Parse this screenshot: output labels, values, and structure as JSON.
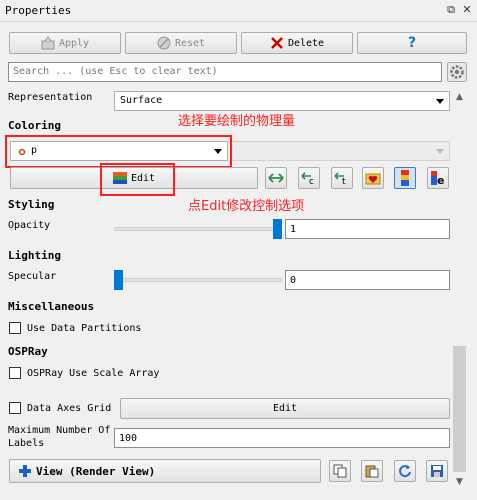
{
  "panel": {
    "title": "Properties"
  },
  "toolbar": {
    "apply": "Apply",
    "reset": "Reset",
    "delete": "Delete",
    "help": "?"
  },
  "search": {
    "placeholder": "Search ... (use Esc to clear text)"
  },
  "representation": {
    "label": "Representation",
    "value": "Surface"
  },
  "coloring": {
    "section": "Coloring",
    "array": "p",
    "edit": "Edit",
    "annotation_select": "选择要绘制的物理量",
    "annotation_edit": "点Edit修改控制选项"
  },
  "styling": {
    "section": "Styling",
    "opacity_label": "Opacity",
    "opacity_value": "1",
    "opacity_fraction": 1.0
  },
  "lighting": {
    "section": "Lighting",
    "specular_label": "Specular",
    "specular_value": "0",
    "specular_fraction": 0.0
  },
  "miscellaneous": {
    "section": "Miscellaneous",
    "use_data_partitions": "Use Data Partitions"
  },
  "ospray": {
    "section": "OSPRay",
    "use_scale_array": "OSPRay Use Scale Array"
  },
  "axes_grid": {
    "label": "Data Axes Grid",
    "edit": "Edit"
  },
  "labels": {
    "label_line1": "Maximum Number Of",
    "label_line2": "Labels",
    "value": "100"
  },
  "view": {
    "title": "View (Render View)"
  },
  "colors": {
    "accent": "#0078d7",
    "annotation": "#ff2020",
    "help": "#1e70c8",
    "delete": "#cc0000"
  }
}
